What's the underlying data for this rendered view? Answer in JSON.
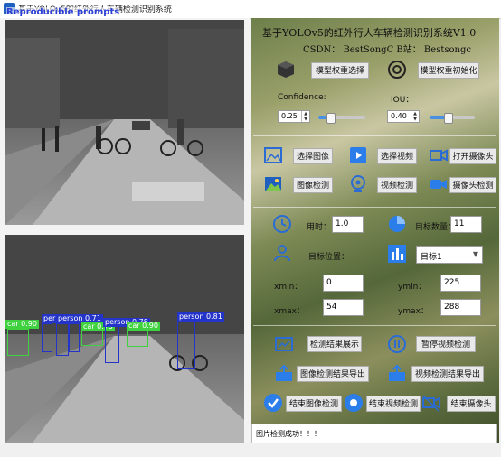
{
  "window": {
    "title": "基于YOLOv5的红外行人车辆检测识别系统",
    "overlay_text": "Reproducible prompts"
  },
  "header": {
    "title": "基于YOLOv5的红外行人车辆检测识别系统V1.0",
    "subtitle": "CSDN：  BestSongC   B站：  Bestsongc"
  },
  "model": {
    "select_label": "模型权重选择",
    "init_label": "模型权重初始化"
  },
  "params": {
    "confidence_label": "Confidence:",
    "confidence_value": "0.25",
    "confidence_level": 0.25,
    "iou_label": "IOU：",
    "iou_value": "0.40",
    "iou_level": 0.4
  },
  "input": {
    "select_image": "选择图像",
    "select_video": "选择视频",
    "open_camera": "打开摄像头",
    "image_detect": "图像检测",
    "video_detect": "视频检测",
    "camera_detect": "摄像头检测"
  },
  "results": {
    "time_label": "用时：",
    "time_value": "1.0",
    "count_label": "目标数量：",
    "count_value": "11",
    "position_label": "目标位置：",
    "target_selected": "目标1",
    "xmin_label": "xmin：",
    "xmin_value": "0",
    "ymin_label": "ymin：",
    "ymin_value": "225",
    "xmax_label": "xmax：",
    "xmax_value": "54",
    "ymax_label": "ymax：",
    "ymax_value": "288"
  },
  "actions": {
    "show_results": "检测结果展示",
    "pause_video": "暂停视频检测",
    "export_image": "图像检测结果导出",
    "export_video": "视频检测结果导出",
    "end_image": "结束图像检测",
    "end_video": "结束视频检测",
    "end_camera": "结束摄像头"
  },
  "detections": [
    {
      "label": "car 0.90",
      "color": "#3fd13f"
    },
    {
      "label": "person 0.71",
      "color": "#2433c8"
    },
    {
      "label": "person 0.78",
      "color": "#2433c8"
    },
    {
      "label": "per",
      "color": "#2433c8"
    },
    {
      "label": "car 0.75",
      "color": "#3fd13f"
    },
    {
      "label": "car 0.90",
      "color": "#3fd13f"
    },
    {
      "label": "person 0.81",
      "color": "#2433c8"
    }
  ],
  "status": {
    "message": "图片检测成功！！！"
  },
  "colors": {
    "person_box": "#2433c8",
    "car_box": "#3fd13f",
    "button_bg": "#e9e9e9"
  }
}
